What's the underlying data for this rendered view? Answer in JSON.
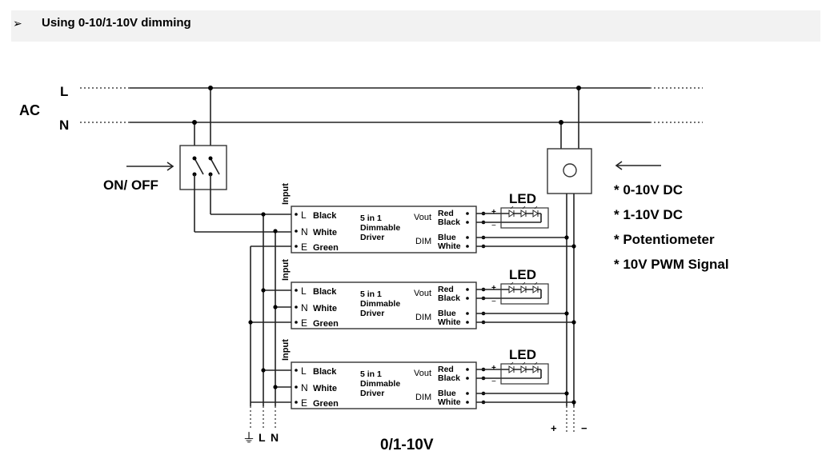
{
  "header": {
    "bullet": "➢",
    "title": "Using 0-10/1-10V dimming"
  },
  "diagram": {
    "ac_label": "AC",
    "line_l_label": "L",
    "line_n_label": "N",
    "switch_label": "ON/ OFF",
    "bottom_labels": {
      "earth_symbol": "⏚",
      "l": "L",
      "n": "N"
    },
    "bottom_title": "0/1-10V",
    "dc_plus": "+",
    "dc_minus": "−",
    "dimmer_options": [
      "* 0-10V DC",
      "* 1-10V DC",
      "* Potentiometer",
      "* 10V PWM Signal"
    ],
    "drivers": [
      {
        "input_label": "Input",
        "pins_left": [
          {
            "pin": "L",
            "color": "Black"
          },
          {
            "pin": "N",
            "color": "White"
          },
          {
            "pin": "E",
            "color": "Green"
          }
        ],
        "name_lines": [
          "5 in 1",
          "Dimmable",
          "Driver"
        ],
        "vout_label": "Vout",
        "vout_colors": [
          "Red",
          "Black"
        ],
        "dim_label": "DIM",
        "dim_colors": [
          "Blue",
          "White"
        ],
        "led_label": "LED",
        "led_plus": "+",
        "led_minus": "−"
      },
      {
        "input_label": "Input",
        "pins_left": [
          {
            "pin": "L",
            "color": "Black"
          },
          {
            "pin": "N",
            "color": "White"
          },
          {
            "pin": "E",
            "color": "Green"
          }
        ],
        "name_lines": [
          "5 in 1",
          "Dimmable",
          "Driver"
        ],
        "vout_label": "Vout",
        "vout_colors": [
          "Red",
          "Black"
        ],
        "dim_label": "DIM",
        "dim_colors": [
          "Blue",
          "White"
        ],
        "led_label": "LED",
        "led_plus": "+",
        "led_minus": "−"
      },
      {
        "input_label": "Input",
        "pins_left": [
          {
            "pin": "L",
            "color": "Black"
          },
          {
            "pin": "N",
            "color": "White"
          },
          {
            "pin": "E",
            "color": "Green"
          }
        ],
        "name_lines": [
          "5 in 1",
          "Dimmable",
          "Driver"
        ],
        "vout_label": "Vout",
        "vout_colors": [
          "Red",
          "Black"
        ],
        "dim_label": "DIM",
        "dim_colors": [
          "Blue",
          "White"
        ],
        "led_label": "LED",
        "led_plus": "+",
        "led_minus": "−"
      }
    ]
  }
}
